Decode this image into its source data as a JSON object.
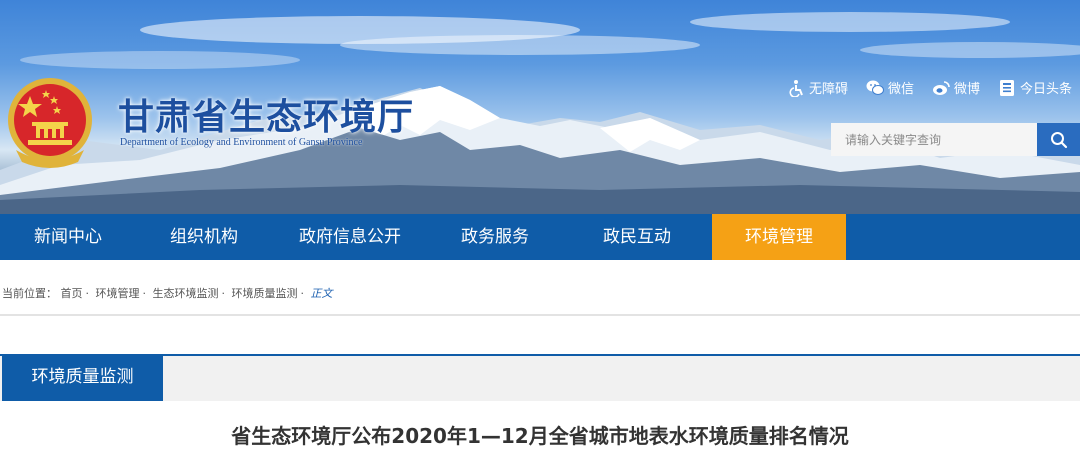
{
  "header": {
    "site_title": "甘肃省生态环境厅",
    "site_subtitle": "Department of Ecology and Environment of Gansu Province",
    "top_links": [
      {
        "label": "无障碍",
        "icon": "accessibility-icon"
      },
      {
        "label": "微信",
        "icon": "wechat-icon"
      },
      {
        "label": "微博",
        "icon": "weibo-icon"
      },
      {
        "label": "今日头条",
        "icon": "toutiao-icon"
      }
    ],
    "search": {
      "placeholder": "请输入关键字查询",
      "icon": "search-icon"
    }
  },
  "nav": {
    "items": [
      {
        "label": "新闻中心"
      },
      {
        "label": "组织机构"
      },
      {
        "label": "政府信息公开"
      },
      {
        "label": "政务服务"
      },
      {
        "label": "政民互动"
      },
      {
        "label": "环境管理"
      }
    ],
    "active_index": 5
  },
  "breadcrumb": {
    "prefix": "当前位置：",
    "items": [
      "首页",
      "环境管理",
      "生态环境监测",
      "环境质量监测"
    ],
    "current": "正文"
  },
  "section": {
    "label": "环境质量监测"
  },
  "article": {
    "title": "省生态环境厅公布2020年1—12月全省城市地表水环境质量排名情况"
  },
  "colors": {
    "nav_bg": "#0f5ca8",
    "nav_active": "#f5a115",
    "title_blue": "#1d4f9f",
    "search_btn": "#2a6cbf"
  }
}
